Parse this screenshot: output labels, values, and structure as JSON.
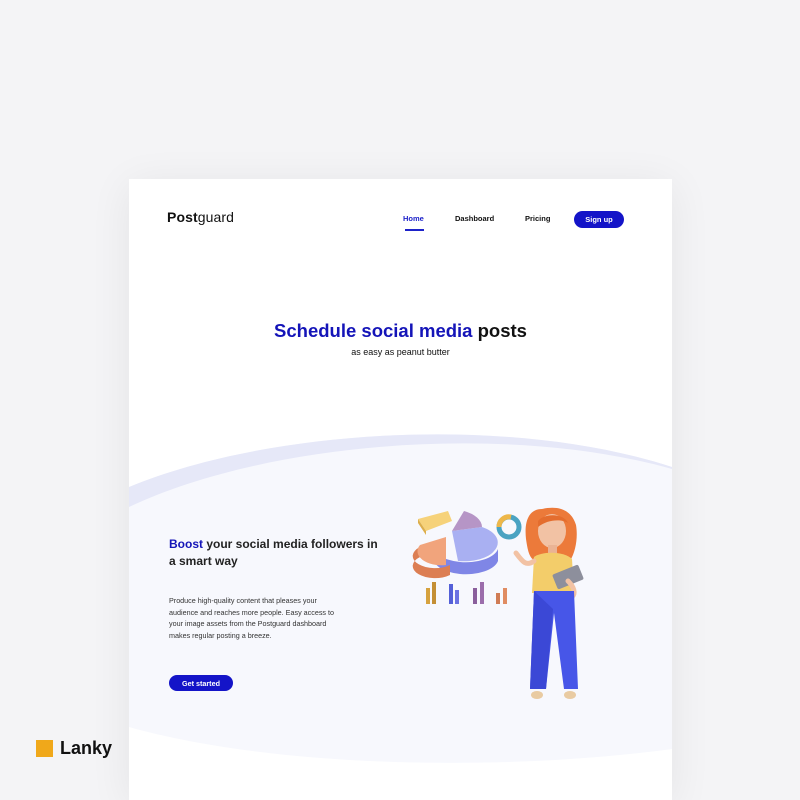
{
  "header": {
    "logo_bold": "Post",
    "logo_light": "guard",
    "nav": {
      "home": "Home",
      "dashboard": "Dashboard",
      "pricing": "Pricing"
    },
    "signup_label": "Sign up"
  },
  "hero": {
    "title_blue": "Schedule  social media",
    "title_dark": " posts",
    "subtitle": "as easy as peanut butter"
  },
  "feature": {
    "title_blue": "Boost",
    "title_rest": " your social media followers in a smart way",
    "description": "Produce high-quality content that pleases your audience and reaches more people. Easy access to your image assets from the Postguard dashboard makes regular posting a breeze.",
    "cta_label": "Get started"
  },
  "brand": {
    "name": "Lanky"
  },
  "colors": {
    "primary": "#1414c8",
    "accent": "#f0a81a",
    "background": "#f4f4f6",
    "wave": "#e6e8f8"
  },
  "icons": [
    "pie-chart-3d-icon",
    "donut-ring-icon",
    "bar-chart-icon",
    "character-illustration"
  ]
}
